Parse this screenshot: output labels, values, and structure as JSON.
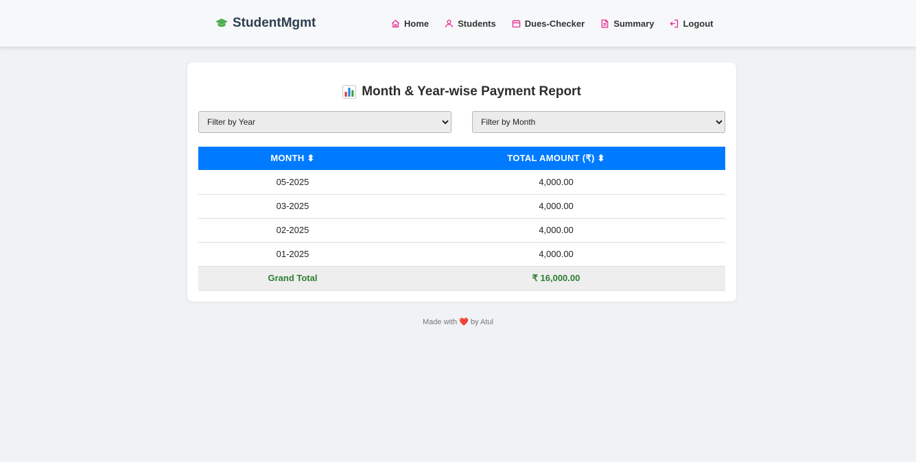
{
  "navbar": {
    "brand": "StudentMgmt",
    "brand_icon": "graduation-cap-icon",
    "links": [
      {
        "label": "Home",
        "icon": "home-icon"
      },
      {
        "label": "Students",
        "icon": "user-icon"
      },
      {
        "label": "Dues-Checker",
        "icon": "calendar-icon"
      },
      {
        "label": "Summary",
        "icon": "document-icon"
      },
      {
        "label": "Logout",
        "icon": "logout-icon"
      }
    ],
    "icon_color": "#e91e8c",
    "brand_icon_color": "#4caf50"
  },
  "report": {
    "title": "Month & Year-wise Payment Report",
    "title_icon": "bar-chart-icon",
    "filters": {
      "year_selected": "Filter by Year",
      "month_selected": "Filter by Month"
    },
    "columns": [
      "MONTH ⬍",
      "TOTAL AMOUNT (₹) ⬍"
    ],
    "rows": [
      {
        "month": "05-2025",
        "amount": "4,000.00"
      },
      {
        "month": "03-2025",
        "amount": "4,000.00"
      },
      {
        "month": "02-2025",
        "amount": "4,000.00"
      },
      {
        "month": "01-2025",
        "amount": "4,000.00"
      }
    ],
    "total": {
      "label": "Grand Total",
      "amount": "₹ 16,000.00"
    },
    "header_color": "#007bff",
    "total_color": "#2e7d32"
  },
  "footer": {
    "prefix": "Made with",
    "heart": "❤️",
    "suffix": "by Atul"
  }
}
